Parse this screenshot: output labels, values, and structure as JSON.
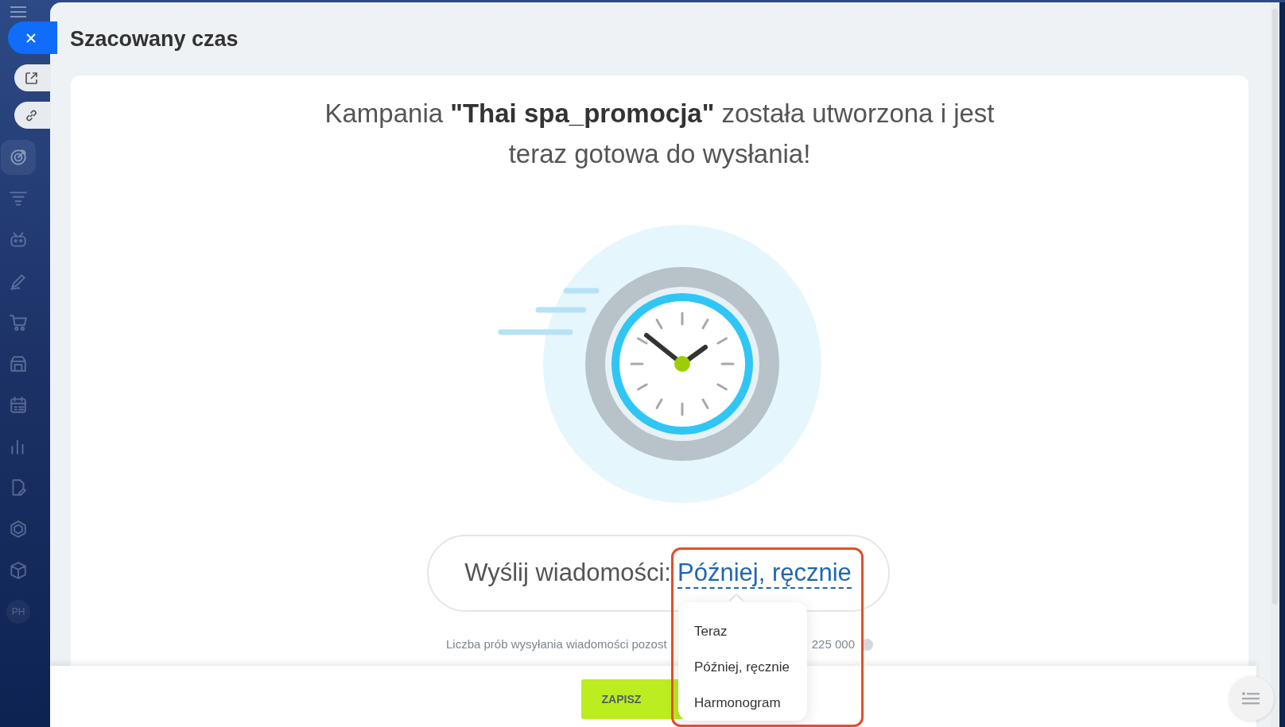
{
  "sidebar": {
    "items": [
      {
        "kind": "target",
        "selected": true
      },
      {
        "kind": "filter",
        "selected": false
      },
      {
        "kind": "robot",
        "selected": false
      },
      {
        "kind": "pencil",
        "selected": false
      },
      {
        "kind": "cart",
        "selected": false
      },
      {
        "kind": "store",
        "selected": false
      },
      {
        "kind": "calendar",
        "selected": false
      },
      {
        "kind": "chart",
        "selected": false
      },
      {
        "kind": "document",
        "selected": false
      },
      {
        "kind": "hexagon",
        "selected": false
      },
      {
        "kind": "box",
        "selected": false
      },
      {
        "kind": "avatar",
        "text": "PH",
        "selected": false
      }
    ]
  },
  "panel": {
    "title": "Szacowany czas"
  },
  "headline": "Kampania **\"Thai spa_promocja\"** została utworzona i jest teraz gotowa do wysłania!",
  "send": {
    "label": "Wyślij wiadomości:",
    "value": "Później, ręcznie"
  },
  "limit": {
    "text_start": "Liczba prób wysyłania wiadomości pozost",
    "text_end": "225 000"
  },
  "dropdown": {
    "items": [
      {
        "label": "Teraz"
      },
      {
        "label": "Później, ręcznie"
      },
      {
        "label": "Harmonogram"
      }
    ]
  },
  "footer": {
    "save_button": "ZAPISZ"
  },
  "annotation": {
    "on": true
  }
}
